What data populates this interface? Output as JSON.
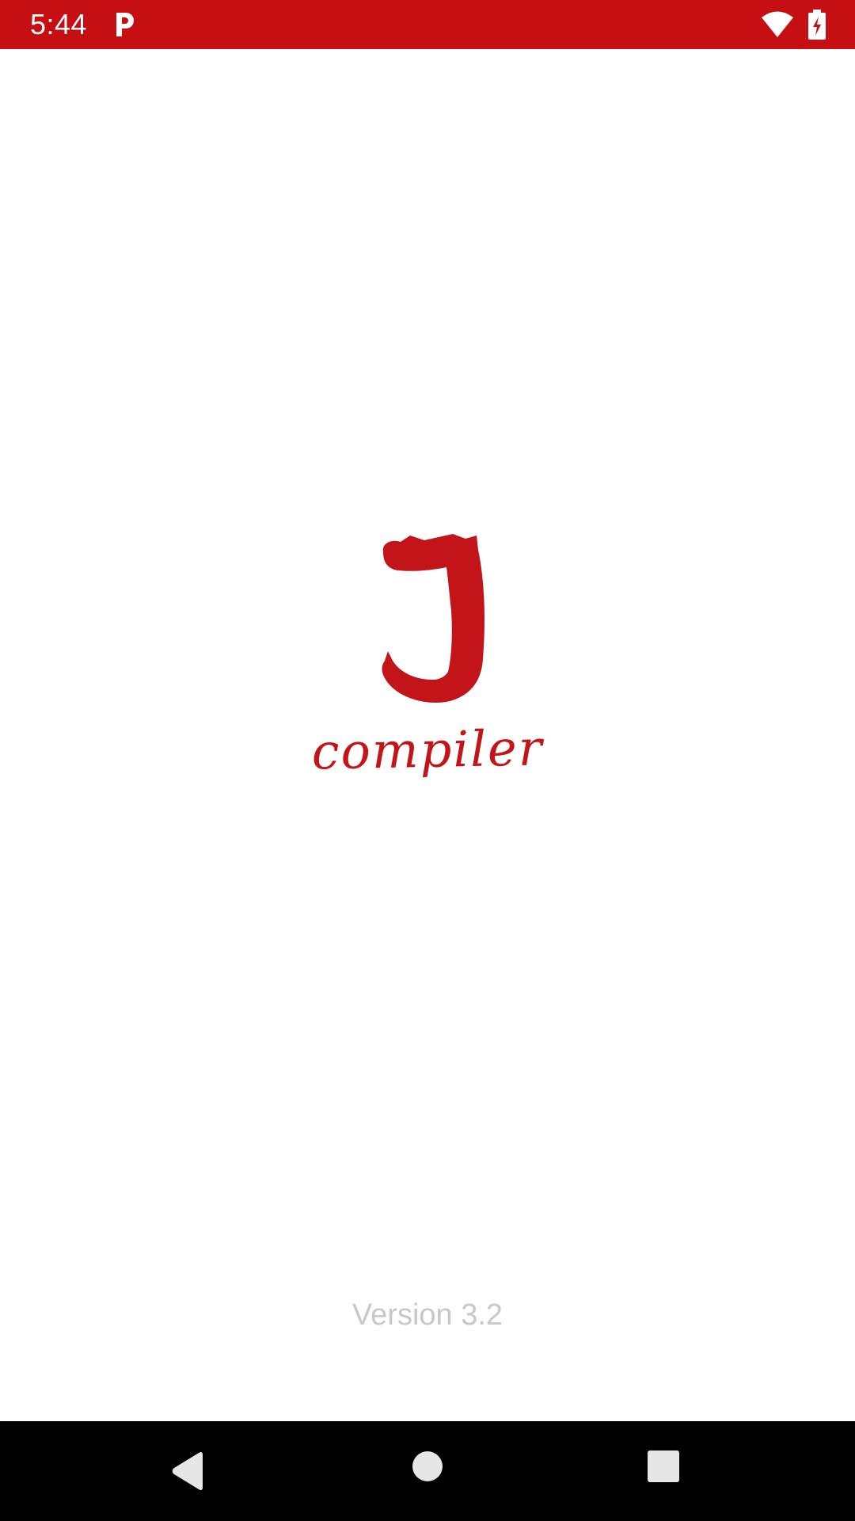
{
  "status_bar": {
    "time": "5:44",
    "icons": [
      "p-notification-icon",
      "wifi-icon",
      "battery-charging-icon"
    ],
    "background_color": "#c50f13"
  },
  "splash": {
    "logo_text": "compiler",
    "logo_color": "#c31419",
    "version": "Version 3.2"
  },
  "nav_bar": {
    "buttons": [
      "back-icon",
      "home-icon",
      "recents-icon"
    ]
  }
}
